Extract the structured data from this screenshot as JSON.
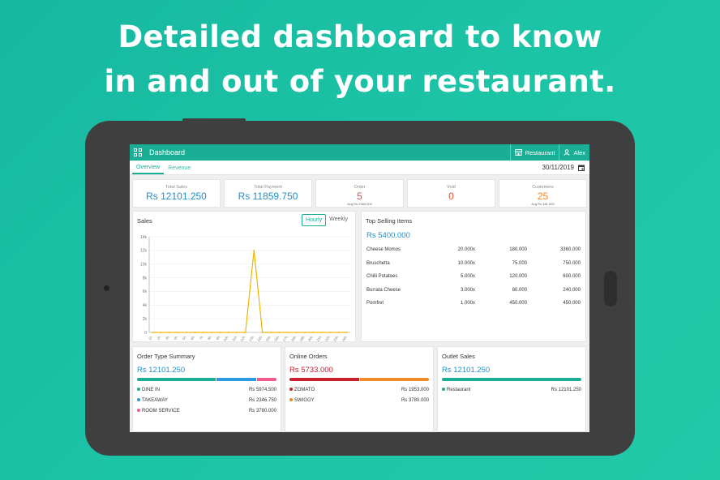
{
  "headline": {
    "line1": "Detailed dashboard to know",
    "line2": "in and out of your restaurant."
  },
  "app": {
    "title": "Dashboard",
    "restaurant_label": "Restaurant",
    "user_label": "Alex",
    "tabs": [
      {
        "label": "Overview",
        "active": true
      },
      {
        "label": "Revenue",
        "active": false
      }
    ],
    "date": "30/11/2019"
  },
  "stats": [
    {
      "label": "Total Sales",
      "value": "Rs 12101.250",
      "color": "#1f8fc9",
      "avg": ""
    },
    {
      "label": "Total Payment",
      "value": "Rs 11859.750",
      "color": "#1f8fc9",
      "avg": ""
    },
    {
      "label": "Order",
      "value": "5",
      "color": "#e0533f",
      "avg": "Avg Rs 2369.000"
    },
    {
      "label": "Void",
      "value": "0",
      "color": "#e0533f",
      "avg": ""
    },
    {
      "label": "Customers",
      "value": "25",
      "color": "#f08b2a",
      "avg": "Avg Rs 481.000"
    }
  ],
  "sales": {
    "title": "Sales",
    "toggle_hourly": "Hourly",
    "toggle_weekly": "Weekly"
  },
  "chart_data": {
    "type": "line",
    "title": "Sales",
    "xlabel": "",
    "ylabel": "",
    "ylim": [
      0,
      14000
    ],
    "yticks": [
      "0",
      "2k",
      "4k",
      "6k",
      "8k",
      "10k",
      "12k",
      "14k"
    ],
    "categories": [
      "1h",
      "2h",
      "3h",
      "4h",
      "5h",
      "6h",
      "7h",
      "8h",
      "9h",
      "10h",
      "11h",
      "12h",
      "13h",
      "14h",
      "15h",
      "16h",
      "17h",
      "18h",
      "19h",
      "20h",
      "21h",
      "22h",
      "23h",
      "24h"
    ],
    "values": [
      0,
      0,
      0,
      0,
      0,
      0,
      0,
      0,
      0,
      0,
      0,
      0,
      12000,
      0,
      0,
      0,
      0,
      0,
      0,
      0,
      0,
      0,
      0,
      0
    ],
    "color": "#f0b400",
    "grid": true
  },
  "top_selling": {
    "title": "Top Selling Items",
    "total": "Rs 5400.000",
    "items": [
      {
        "name": "Cheese Momos",
        "qty": "20.000x",
        "price": "180.000",
        "total": "3360.000"
      },
      {
        "name": "Bruschetta",
        "qty": "10.000x",
        "price": "75.000",
        "total": "750.000"
      },
      {
        "name": "Chilli Potatoes",
        "qty": "5.000x",
        "price": "120.000",
        "total": "600.000"
      },
      {
        "name": "Burrata Cheese",
        "qty": "3.000x",
        "price": "80.000",
        "total": "240.000"
      },
      {
        "name": "Pomfret",
        "qty": "1.000x",
        "price": "450.000",
        "total": "450.000"
      }
    ]
  },
  "order_type": {
    "title": "Order Type Summary",
    "total": "Rs 12101.250",
    "total_color": "#1f8fc9",
    "rows": [
      {
        "label": "DINE IN",
        "amount": "Rs 5974.500",
        "color": "#1aae97",
        "share": 0.57
      },
      {
        "label": "TAKEAWAY",
        "amount": "Rs 2346.750",
        "color": "#2b9be0",
        "share": 0.29
      },
      {
        "label": "ROOM SERVICE",
        "amount": "Rs 3780.000",
        "color": "#ee5b8c",
        "share": 0.14
      }
    ]
  },
  "online_orders": {
    "title": "Online Orders",
    "total": "Rs 5733.000",
    "total_color": "#c8202e",
    "rows": [
      {
        "label": "ZOMATO",
        "amount": "Rs 1953.000",
        "color": "#c8202e",
        "share": 0.5
      },
      {
        "label": "SWIGGY",
        "amount": "Rs 3780.000",
        "color": "#f08b2a",
        "share": 0.5
      }
    ]
  },
  "outlet_sales": {
    "title": "Outlet Sales",
    "total": "Rs 12101.250",
    "total_color": "#1f8fc9",
    "rows": [
      {
        "label": "Restaurant",
        "amount": "Rs 12101.250",
        "color": "#1aae97",
        "share": 1.0
      }
    ]
  }
}
